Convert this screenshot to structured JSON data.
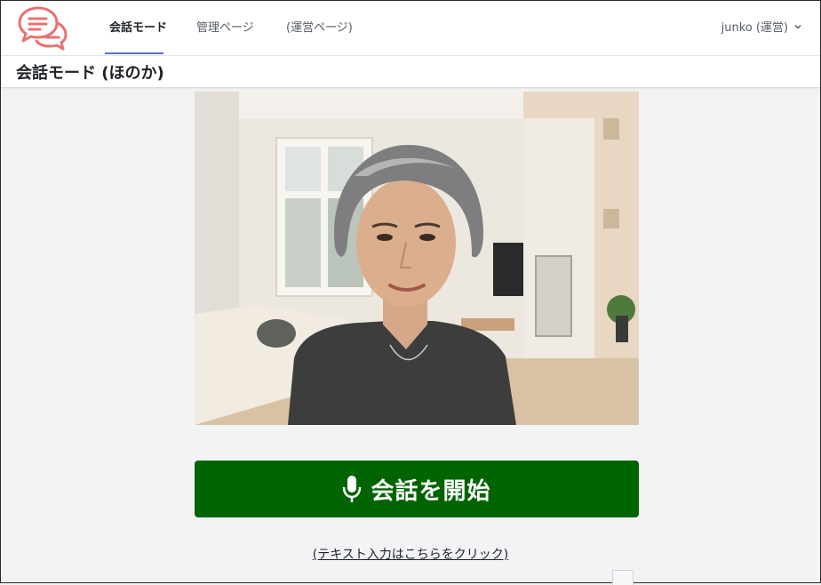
{
  "nav": {
    "tabs": [
      {
        "label": "会話モード",
        "active": true
      },
      {
        "label": "管理ページ",
        "active": false
      },
      {
        "label": "(運営ページ)",
        "active": false
      }
    ],
    "user_label": "junko (運営)",
    "logo_icon": "chat-bubbles-icon",
    "logo_color": "#e8716f",
    "underline_color": "#5b6fd6"
  },
  "page": {
    "title": "会話モード (ほのか)"
  },
  "avatar": {
    "image_alt": "avatar-portrait"
  },
  "actions": {
    "start_label": "会話を開始",
    "start_icon": "microphone-icon",
    "start_color": "#006400",
    "text_input_link": "(テキスト入力はこちらをクリック)"
  }
}
